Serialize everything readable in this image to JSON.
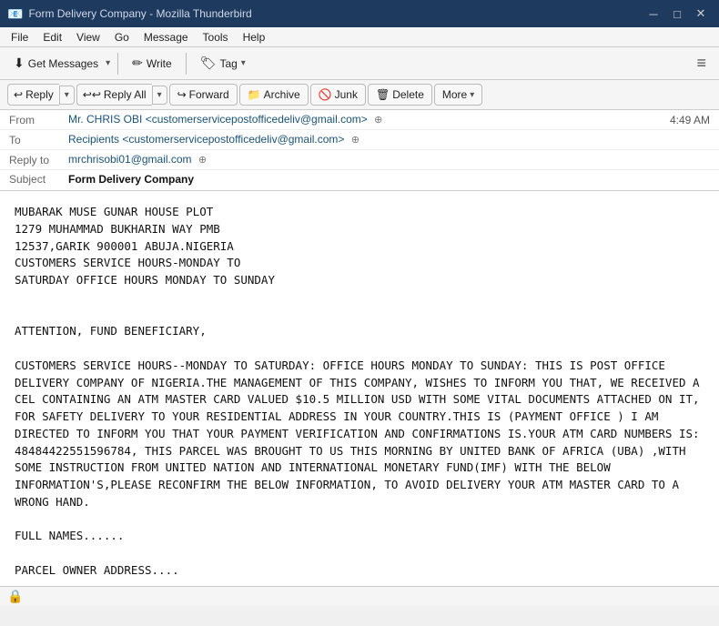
{
  "titlebar": {
    "title": "Form Delivery Company - Mozilla Thunderbird",
    "icon": "🦅"
  },
  "menubar": {
    "items": [
      "File",
      "Edit",
      "View",
      "Go",
      "Message",
      "Tools",
      "Help"
    ]
  },
  "toolbar": {
    "get_messages": "Get Messages",
    "write": "Write",
    "tag": "Tag",
    "hamburger": "≡"
  },
  "actions": {
    "reply": "Reply",
    "reply_all": "Reply All",
    "forward": "Forward",
    "archive": "Archive",
    "junk": "Junk",
    "delete": "Delete",
    "more": "More"
  },
  "email": {
    "from_label": "From",
    "from_name": "Mr. CHRIS OBI",
    "from_address": "<customerservicepostofficedeliv@gmail.com>",
    "to_label": "To",
    "to_name": "Recipients",
    "to_address": "<customerservicepostofficedeliv@gmail.com>",
    "reply_to_label": "Reply to",
    "reply_to_address": "mrchrisobi01@gmail.com",
    "subject_label": "Subject",
    "subject": "Form Delivery Company",
    "time": "4:49 AM",
    "body": "MUBARAK MUSE GUNAR HOUSE PLOT\n1279 MUHAMMAD BUKHARIN WAY PMB\n12537,GARIK 900001 ABUJA.NIGERIA\nCUSTOMERS SERVICE HOURS-MONDAY TO\nSATURDAY OFFICE HOURS MONDAY TO SUNDAY\n\n\nATTENTION, FUND BENEFICIARY,\n\nCUSTOMERS SERVICE HOURS--MONDAY TO SATURDAY: OFFICE HOURS MONDAY TO SUNDAY: THIS IS POST OFFICE DELIVERY COMPANY OF NIGERIA.THE MANAGEMENT OF THIS COMPANY, WISHES TO INFORM YOU THAT, WE RECEIVED A CEL CONTAINING AN ATM MASTER CARD VALUED $10.5 MILLION USD WITH SOME VITAL DOCUMENTS ATTACHED ON IT, FOR SAFETY DELIVERY TO YOUR RESIDENTIAL ADDRESS IN YOUR COUNTRY.THIS IS (PAYMENT OFFICE ) I AM DIRECTED TO INFORM YOU THAT YOUR PAYMENT VERIFICATION AND CONFIRMATIONS IS.YOUR ATM CARD NUMBERS IS: 48484422551596784, THIS PARCEL WAS BROUGHT TO US THIS MORNING BY UNITED BANK OF AFRICA (UBA) ,WITH SOME INSTRUCTION FROM UNITED NATION AND INTERNATIONAL MONETARY FUND(IMF) WITH THE BELOW INFORMATION'S,PLEASE RECONFIRM THE BELOW INFORMATION, TO AVOID DELIVERY YOUR ATM MASTER CARD TO A WRONG HAND.\n\nFULL NAMES......\n\nPARCEL OWNER ADDRESS....\n\nTEL Phone Number....\n.\nA COPY  OF YOUR WORKING ID CARD\n\nWE WILL REGISTER YOUR PACKAGE AND SEND YOU THE TRACKING NUMBERS BEFORE WE PROCEED FOR SAFETY DELIVERY OF YOUR PACKAGE AS SOON AS YOU RECONFIRM THE REQUIRED INFORMATION'S FOR SAFETY DELIVERY.POST OFFICE IS ONE OF THE WORLD'S GREAT SUCCESS STORIES,THE START UP THAT REVOLUTIONIZED THE DELIVERY OF PACKAGES AND INFORMATION.IN THE PAST 30 YEARS, WE HAVE GROWN UP AND GROWN INTO A DIVERSE FAMILY OF POST OFFICE THAT'S BIGGER, STRONGER,BETTER THAN EVER.\n\nMR CHRIS OBI\nPost Office Delivery Company"
  },
  "statusbar": {
    "icon": "🔒",
    "text": ""
  }
}
